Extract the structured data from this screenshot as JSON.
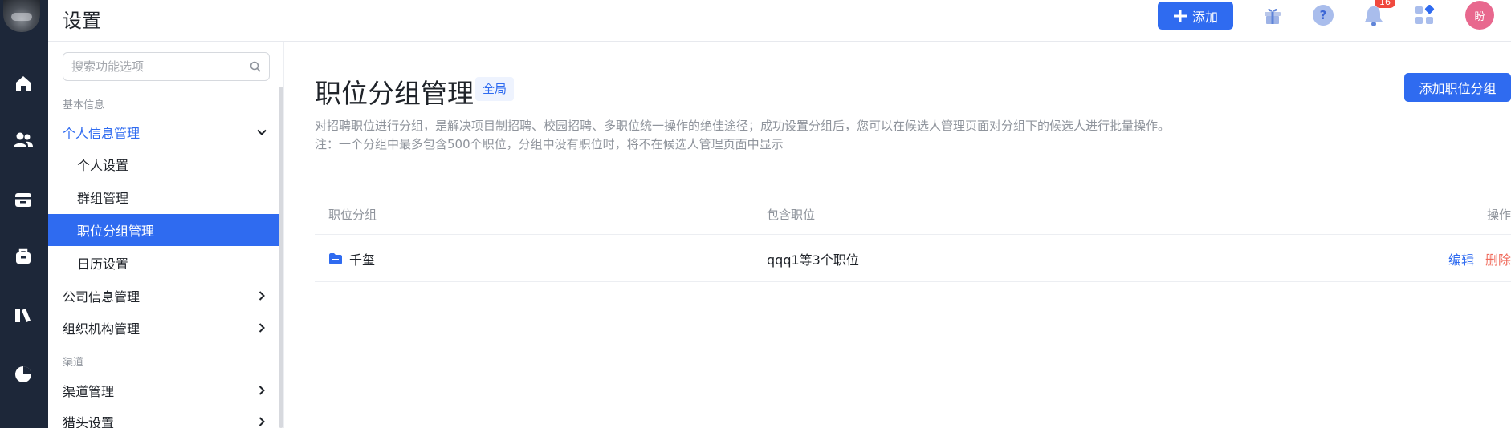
{
  "header": {
    "title": "设置",
    "add_button_label": "添加",
    "notification_count": "16",
    "avatar_text": "盼"
  },
  "rail": {
    "icons": [
      "home-icon",
      "users-icon",
      "calendar-icon",
      "briefcase-icon",
      "book-icon",
      "pie-chart-icon"
    ]
  },
  "sidebar": {
    "search_placeholder": "搜索功能选项",
    "section_basic": "基本信息",
    "personal_info": "个人信息管理",
    "items": [
      "个人设置",
      "群组管理",
      "职位分组管理",
      "日历设置"
    ],
    "company_info": "公司信息管理",
    "org_structure": "组织机构管理",
    "section_channel": "渠道",
    "channel_manage": "渠道管理",
    "headhunter_settings": "猎头设置"
  },
  "main": {
    "title": "职位分组管理",
    "scope_tag": "全局",
    "add_group_button": "添加职位分组",
    "description_line1": "对招聘职位进行分组，是解决项目制招聘、校园招聘、多职位统一操作的绝佳途径；成功设置分组后，您可以在候选人管理页面对分组下的候选人进行批量操作。",
    "description_line2": "注：一个分组中最多包含500个职位，分组中没有职位时，将不在候选人管理页面中显示",
    "table": {
      "columns": [
        "职位分组",
        "包含职位",
        "操作"
      ],
      "rows": [
        {
          "group": "千玺",
          "positions": "qqq1等3个职位",
          "edit": "编辑",
          "delete": "删除"
        }
      ]
    }
  },
  "colors": {
    "accent": "#2f6bf0",
    "rail_bg": "#1d2739",
    "danger": "#f06a5b"
  }
}
